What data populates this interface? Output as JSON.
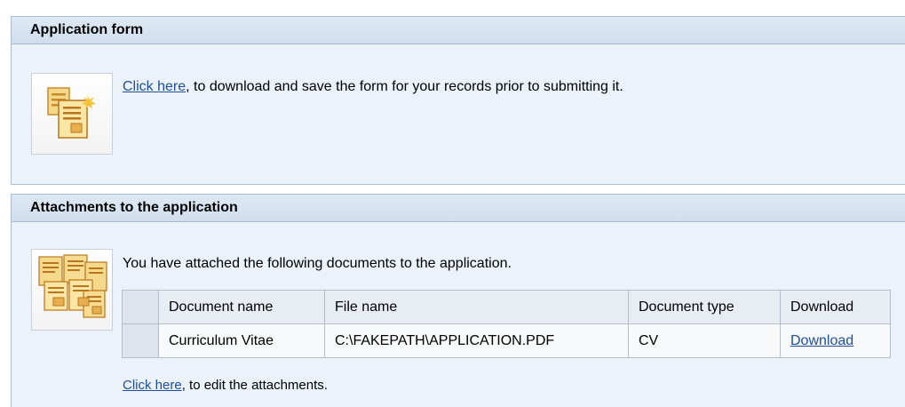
{
  "application_form": {
    "header": "Application form",
    "link_label": "Click here",
    "link_suffix": ", to download and save the form for your records prior to submitting it."
  },
  "attachments": {
    "header": "Attachments to the application",
    "intro": "You have attached the following documents to the application.",
    "columns": [
      "Document name",
      "File name",
      "Document type",
      "Download"
    ],
    "rows": [
      {
        "document_name": "Curriculum Vitae",
        "file_name": "C:\\FAKEPATH\\APPLICATION.PDF",
        "document_type": "CV",
        "download": "Download"
      }
    ],
    "edit_link_label": "Click here",
    "edit_suffix": ", to edit the attachments."
  },
  "icons": {
    "form": "document-form-icon",
    "attachments": "multiple-documents-icon"
  },
  "colors": {
    "header_bg": "#d6e3f1",
    "panel_bg": "#ebf2f9",
    "link": "#1f4e9c",
    "border": "#a9bdd3"
  }
}
